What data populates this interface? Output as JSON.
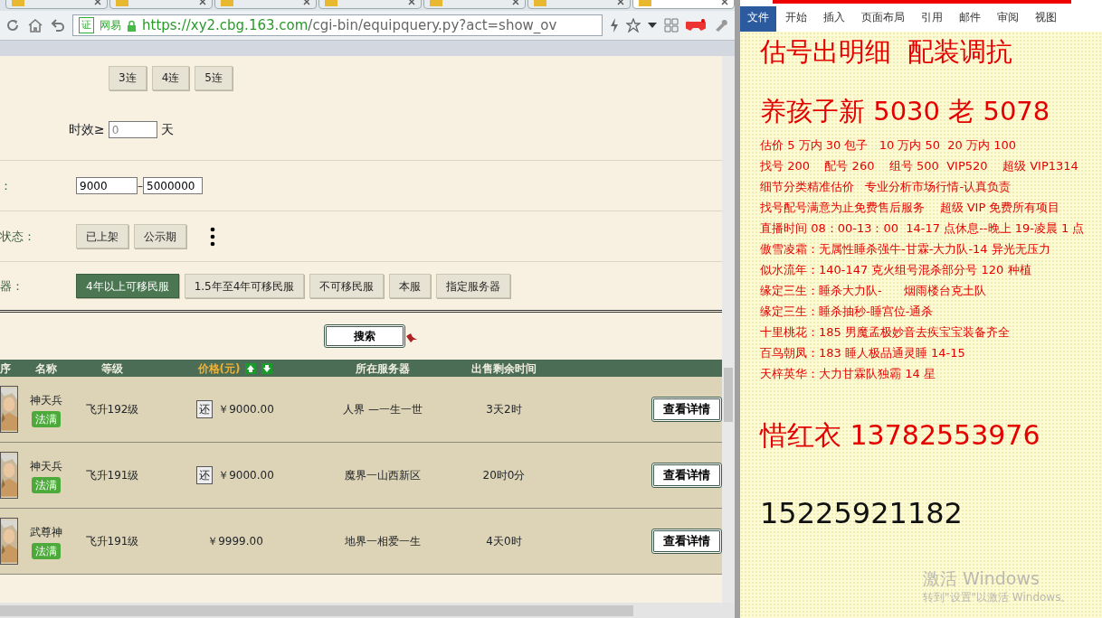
{
  "browser": {
    "tabs": [
      {
        "selected": false
      },
      {
        "selected": false
      },
      {
        "selected": false
      },
      {
        "selected": false
      },
      {
        "selected": false
      },
      {
        "selected": false
      },
      {
        "selected": true
      }
    ],
    "address": {
      "badge": "证",
      "site": "网易",
      "host": "https://xy2.cbg.163.com",
      "path": "/cgi-bin/equipquery.py?act=show_ov"
    }
  },
  "filters": {
    "combo_buttons": [
      "3连",
      "4连",
      "5连"
    ],
    "validity": {
      "label": "时效≥",
      "value": "0",
      "unit": "天"
    },
    "price": {
      "label": "：",
      "min": "9000",
      "separator": "–",
      "max": "5000000"
    },
    "status": {
      "label": "状态：",
      "options": [
        {
          "label": "已上架",
          "selected": false
        },
        {
          "label": "公示期",
          "selected": false
        }
      ]
    },
    "server": {
      "label": "器：",
      "options": [
        {
          "label": "4年以上可移民服",
          "selected": true
        },
        {
          "label": "1.5年至4年可移民服",
          "selected": false
        },
        {
          "label": "不可移民服",
          "selected": false
        },
        {
          "label": "本服",
          "selected": false
        },
        {
          "label": "指定服务器",
          "selected": false
        }
      ]
    },
    "search_button": "搜索"
  },
  "table": {
    "columns": [
      "序",
      "名称",
      "等级",
      "价格(元)",
      "所在服务器",
      "出售剩余时间"
    ],
    "rows": [
      {
        "name": "神天兵",
        "tag": "法满",
        "level": "飞升192级",
        "return_mark": "还",
        "price": "￥9000.00",
        "server": "人界 —一生一世",
        "time": "3天2时",
        "action": "查看详情"
      },
      {
        "name": "神天兵",
        "tag": "法满",
        "level": "飞升191级",
        "return_mark": "还",
        "price": "￥9000.00",
        "server": "魔界一山西新区",
        "time": "20时0分",
        "action": "查看详情"
      },
      {
        "name": "武尊神",
        "tag": "法满",
        "level": "飞升191级",
        "price": "￥9999.00",
        "server": "地界一相爱一生",
        "time": "4天0时",
        "action": "查看详情"
      }
    ]
  },
  "word": {
    "tabs": [
      {
        "label": "文件",
        "selected": true
      },
      {
        "label": "开始",
        "selected": false
      },
      {
        "label": "插入",
        "selected": false
      },
      {
        "label": "页面布局",
        "selected": false
      },
      {
        "label": "引用",
        "selected": false
      },
      {
        "label": "邮件",
        "selected": false
      },
      {
        "label": "审阅",
        "selected": false
      },
      {
        "label": "视图",
        "selected": false
      }
    ],
    "lines": [
      {
        "kind": "heading",
        "text": "估号出明细  配装调抗"
      },
      {
        "kind": "heading",
        "text": "养孩子新 5030 老 5078"
      },
      {
        "kind": "body",
        "text": "估价 5 万内 30 包子   10 万内 50  20 万内 100"
      },
      {
        "kind": "body",
        "text": "找号 200    配号 260    组号 500  VIP520    超级 VIP1314"
      },
      {
        "kind": "body",
        "text": "细节分类精准估价   专业分析市场行情-认真负责"
      },
      {
        "kind": "body",
        "text": "找号配号满意为止免费售后服务    超级 VIP 免费所有项目"
      },
      {
        "kind": "body",
        "text": "直播时间 08：00-13：00  14-17 点休息--晚上 19-凌晨 1 点"
      },
      {
        "kind": "body",
        "text": "傲雪凌霜：无属性睡杀强牛-甘霖-大力队-14 异光无压力"
      },
      {
        "kind": "body",
        "text": "似水流年：140-147 克火组号混杀部分号 120 种植"
      },
      {
        "kind": "body",
        "text": "缘定三生：睡杀大力队-      烟雨楼台克土队"
      },
      {
        "kind": "body",
        "text": "缘定三生：睡杀抽秒-睡宫位-通杀"
      },
      {
        "kind": "body",
        "text": "十里桃花：185 男魔孟极妙音去疾宝宝装备齐全"
      },
      {
        "kind": "body",
        "text": "百鸟朝凤：183 睡人极品通灵睡 14-15"
      },
      {
        "kind": "body",
        "text": "天梓英华：大力甘霖队独霸 14 星"
      },
      {
        "kind": "contact",
        "text": "惜红衣 13782553976"
      },
      {
        "kind": "number",
        "text": "15225921182"
      }
    ]
  },
  "os_notice": {
    "title": "激活 Windows",
    "hint": "转到\"设置\"以激活 Windows。"
  }
}
